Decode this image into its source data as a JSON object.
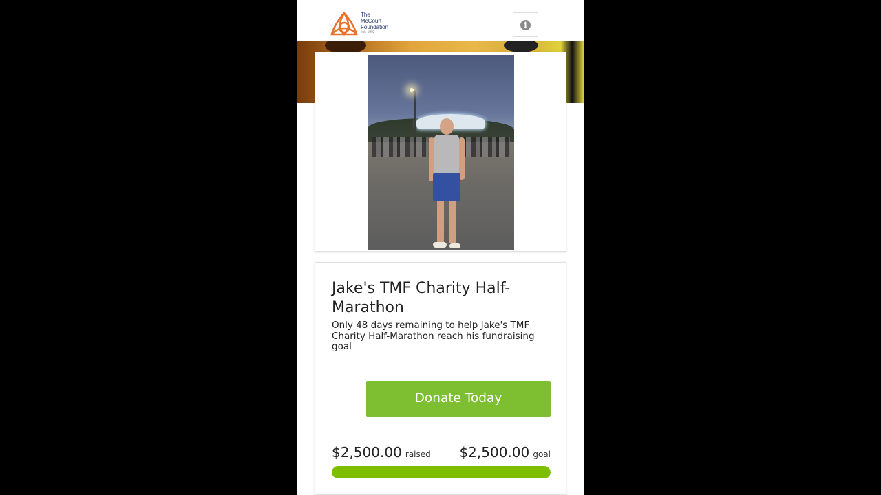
{
  "header": {
    "logo_line1": "The",
    "logo_line2": "McCourt",
    "logo_line3": "Foundation",
    "logo_est": "est. 1992",
    "logo_icon": "trinity-knot-icon",
    "info_icon": "info-icon"
  },
  "campaign": {
    "photo_alt": "Jake standing outdoors at night in running gear",
    "title": "Jake's TMF Charity Half-Marathon",
    "subtitle": "Only 48 days remaining to help Jake's TMF Charity Half-Marathon reach his fundraising goal",
    "donate_label": "Donate Today",
    "raised_amount": "$2,500.00",
    "raised_label": "raised",
    "goal_amount": "$2,500.00",
    "goal_label": "goal",
    "progress_percent": 100
  },
  "colors": {
    "accent_green": "#7dbf30",
    "progress_green": "#7dbf00",
    "logo_orange": "#e8722a",
    "logo_navy": "#2d3a6e"
  }
}
